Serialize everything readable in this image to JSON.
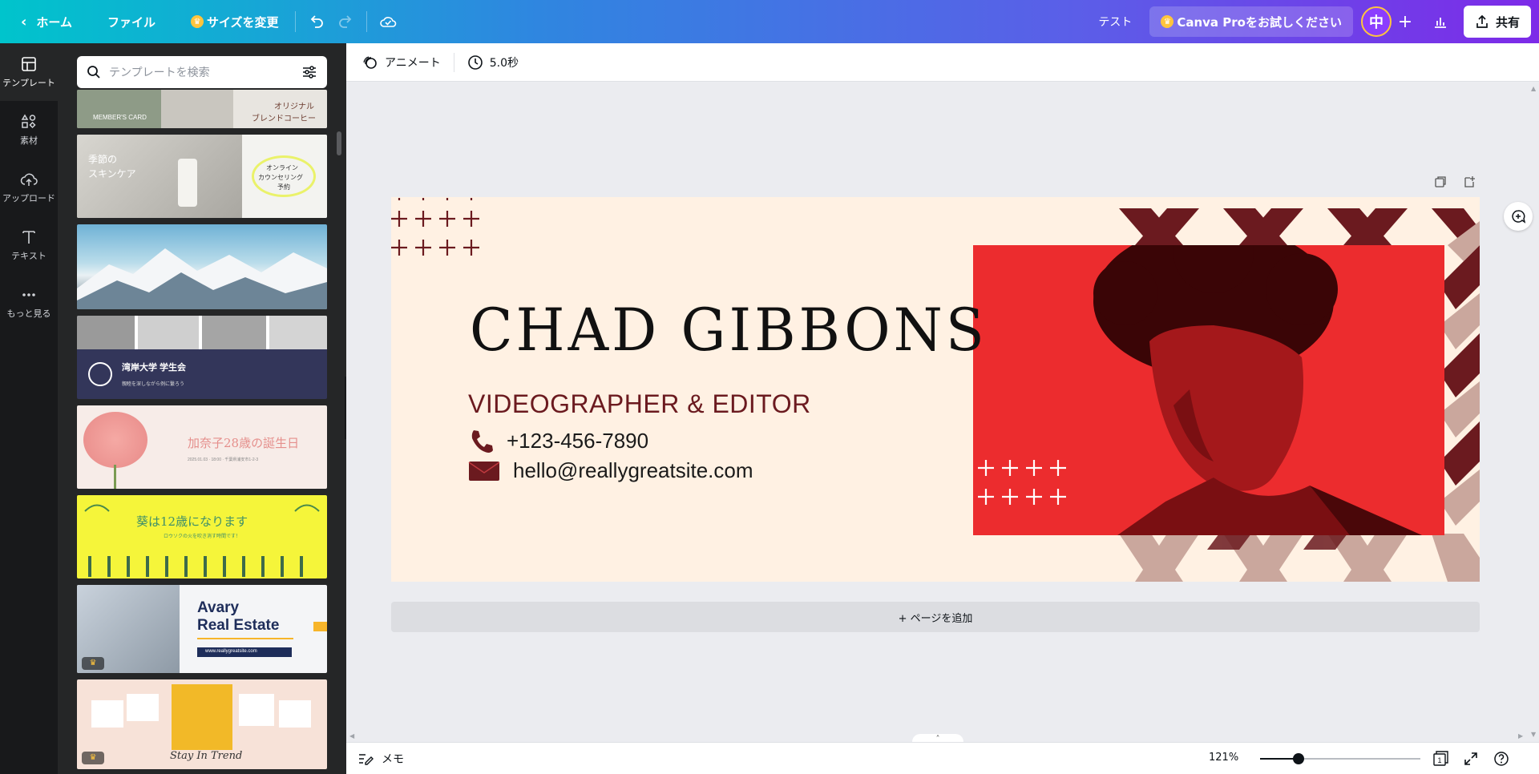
{
  "topbar": {
    "home_label": "ホーム",
    "file_label": "ファイル",
    "resize_label": "サイズを変更",
    "test_label": "テスト",
    "pro_label": "Canva Proをお試しください",
    "avatar_initial": "中",
    "share_label": "共有"
  },
  "rail": {
    "items": [
      {
        "label": "テンプレート",
        "icon": "template-icon"
      },
      {
        "label": "素材",
        "icon": "elements-icon"
      },
      {
        "label": "アップロード",
        "icon": "upload-icon"
      },
      {
        "label": "テキスト",
        "icon": "text-icon"
      },
      {
        "label": "もっと見る",
        "icon": "more-icon"
      }
    ]
  },
  "panel": {
    "search_placeholder": "テンプレートを検索",
    "templates": [
      {
        "texts": [
          "MEMBER'S CARD",
          "オリジナル",
          "ブレンドコーヒー"
        ]
      },
      {
        "texts": [
          "季節の",
          "スキンケア",
          "オンライン",
          "カウンセリング",
          "予約"
        ]
      },
      {
        "texts": []
      },
      {
        "texts": [
          "湾岸大学 学生会",
          "親睦を深しながら例に繋ろう"
        ]
      },
      {
        "texts": [
          "加奈子28歳の誕生日",
          "2025.01.03 · 18:00 · 千葉県浦安市1-2-3"
        ]
      },
      {
        "texts": [
          "葵は12歳になります",
          "ロウソクの火を吹き消す時間です！"
        ]
      },
      {
        "texts": [
          "Avary",
          "Real Estate",
          "www.reallygreatsite.com"
        ]
      },
      {
        "texts": [
          "Stay In Trend"
        ]
      }
    ]
  },
  "toolbar": {
    "animate_label": "アニメート",
    "duration_label": "5.0秒"
  },
  "design": {
    "name": "CHAD GIBBONS",
    "role": "VIDEOGRAPHER & EDITOR",
    "phone": "+123-456-7890",
    "email": "hello@reallygreatsite.com",
    "accent_color": "#6b1a1f",
    "background_color": "#fff1e3",
    "photo_tint": "#e8282d"
  },
  "editor": {
    "add_page_label": "+ ページを追加",
    "notes_label": "メモ",
    "zoom_label": "121%",
    "zoom_slider_fraction": 0.24,
    "page_count": "1"
  }
}
